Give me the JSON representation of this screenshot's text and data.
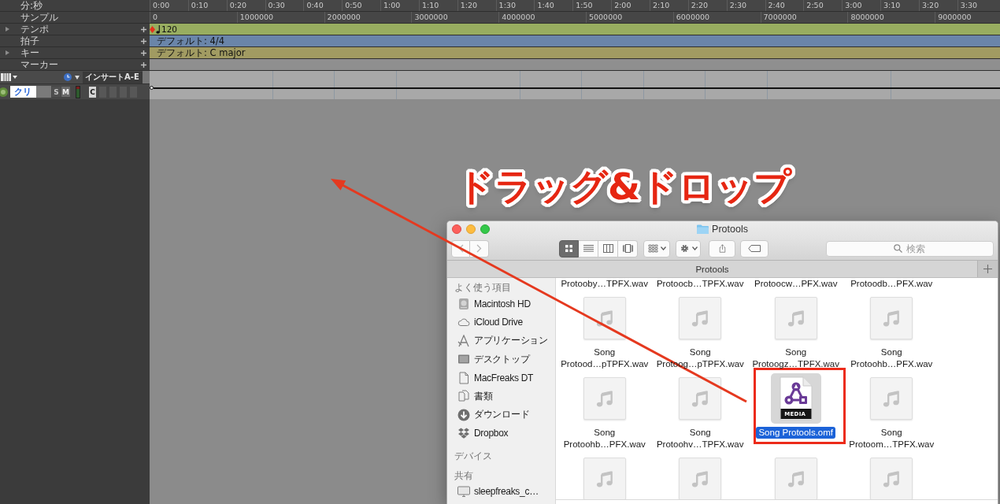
{
  "ruler_rows": [
    {
      "kind": "minsec",
      "label": "分:秒",
      "expandable": false,
      "addable": false,
      "ticks": [
        "0:00",
        "0:10",
        "0:20",
        "0:30",
        "0:40",
        "0:50",
        "1:00",
        "1:10",
        "1:20",
        "1:30",
        "1:40",
        "1:50",
        "2:00",
        "2:10",
        "2:20",
        "2:30",
        "2:40",
        "2:50",
        "3:00",
        "3:10",
        "3:20",
        "3:30"
      ]
    },
    {
      "kind": "samples",
      "label": "サンプル",
      "expandable": false,
      "addable": false,
      "ticks": [
        "0",
        "1000000",
        "2000000",
        "3000000",
        "4000000",
        "5000000",
        "6000000",
        "7000000",
        "8000000",
        "9000000"
      ]
    },
    {
      "kind": "tempo",
      "label": "テンポ",
      "expandable": true,
      "addable": true,
      "value": "120"
    },
    {
      "kind": "meter",
      "label": "拍子",
      "expandable": false,
      "addable": true,
      "value": "デフォルト: 4/4"
    },
    {
      "kind": "key",
      "label": "キー",
      "expandable": true,
      "addable": true,
      "value": "デフォルト: C major"
    },
    {
      "kind": "marker",
      "label": "マーカー",
      "expandable": false,
      "addable": true
    }
  ],
  "track": {
    "insert_header": "インサートA-E",
    "name": "クリ",
    "buttons": [
      {
        "kind": "solo",
        "label": "S",
        "on": false
      },
      {
        "kind": "mute",
        "label": "M",
        "on": false
      }
    ],
    "inserts": [
      "C"
    ]
  },
  "caption": "ドラッグ&ドロップ",
  "finder": {
    "title": "Protools",
    "view_modes": [
      {
        "kind": "icons",
        "selected": true
      },
      {
        "kind": "list",
        "selected": false
      },
      {
        "kind": "columns",
        "selected": false
      },
      {
        "kind": "coverflow",
        "selected": false
      }
    ],
    "search": {
      "placeholder": "検索"
    },
    "tab": "Protools",
    "sidebar": [
      {
        "heading": "よく使う項目",
        "items": [
          {
            "kind": "disk",
            "label": "Macintosh HD"
          },
          {
            "kind": "cloud",
            "label": "iCloud Drive"
          },
          {
            "kind": "apps",
            "label": "アプリケーション"
          },
          {
            "kind": "desktop",
            "label": "デスクトップ"
          },
          {
            "kind": "document",
            "label": "MacFreaks DT"
          },
          {
            "kind": "documents",
            "label": "書類"
          },
          {
            "kind": "download",
            "label": "ダウンロード"
          },
          {
            "kind": "dropbox",
            "label": "Dropbox"
          }
        ]
      },
      {
        "heading": "デバイス"
      },
      {
        "heading": "共有",
        "items": [
          {
            "kind": "computer",
            "label": "sleepfreaks_c…"
          }
        ]
      }
    ],
    "files": [
      {
        "kind": "label",
        "lines": [
          "Protooby…TPFX.wav"
        ],
        "selected": false
      },
      {
        "kind": "label",
        "lines": [
          "Protoocb…TPFX.wav"
        ],
        "selected": false
      },
      {
        "kind": "label",
        "lines": [
          "Protoocw…PFX.wav"
        ],
        "selected": false
      },
      {
        "kind": "label",
        "lines": [
          "Protoodb…PFX.wav"
        ],
        "selected": false
      },
      {
        "kind": "audio",
        "lines": [
          "Song",
          "Protood…pTPFX.wav"
        ],
        "selected": false
      },
      {
        "kind": "audio",
        "lines": [
          "Song",
          "Protoog…pTPFX.wav"
        ],
        "selected": false
      },
      {
        "kind": "audio",
        "lines": [
          "Song",
          "Protoogz…TPFX.wav"
        ],
        "selected": false
      },
      {
        "kind": "audio",
        "lines": [
          "Song",
          "Protoohb…PFX.wav"
        ],
        "selected": false
      },
      {
        "kind": "audio",
        "lines": [
          "Song",
          "Protoohb…PFX.wav"
        ],
        "selected": false
      },
      {
        "kind": "audio",
        "lines": [
          "Song",
          "Protoohv…TPFX.wav"
        ],
        "selected": false
      },
      {
        "kind": "omf",
        "lines": [
          "Song Protools.omf"
        ],
        "badge": "MEDIA",
        "selected": true,
        "highlight": true
      },
      {
        "kind": "audio",
        "lines": [
          "Song",
          "Protoom…TPFX.wav"
        ],
        "selected": false
      },
      {
        "kind": "icon",
        "selected": false
      },
      {
        "kind": "icon",
        "selected": false
      },
      {
        "kind": "icon",
        "selected": false
      },
      {
        "kind": "icon",
        "selected": false
      }
    ]
  }
}
